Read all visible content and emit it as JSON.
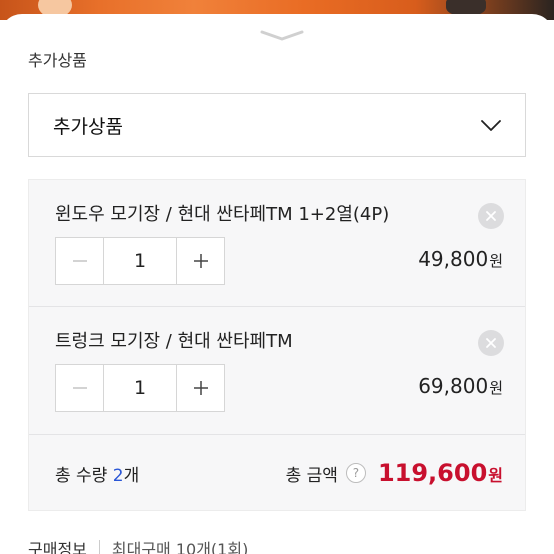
{
  "section_label": "추가상품",
  "select": {
    "value": "추가상품",
    "icon": "chevron-down-icon"
  },
  "items": [
    {
      "name": "윈도우 모기장 / 현대 싼타페TM 1+2열(4P)",
      "quantity": "1",
      "price": "49,800",
      "currency": "원"
    },
    {
      "name": "트렁크 모기장 / 현대 싼타페TM",
      "quantity": "1",
      "price": "69,800",
      "currency": "원"
    }
  ],
  "summary": {
    "qty_prefix": "총 수량 ",
    "qty_value": "2",
    "qty_suffix": "개",
    "amount_label": "총 금액",
    "help": "?",
    "amount_value": "119,600",
    "currency": "원"
  },
  "purchase_info": {
    "label": "구매정보",
    "value": "최대구매 10개(1회)"
  },
  "colors": {
    "accent_price": "#c8102e",
    "qty_blue": "#2a56d6",
    "panel_bg": "#f7f7f8"
  }
}
